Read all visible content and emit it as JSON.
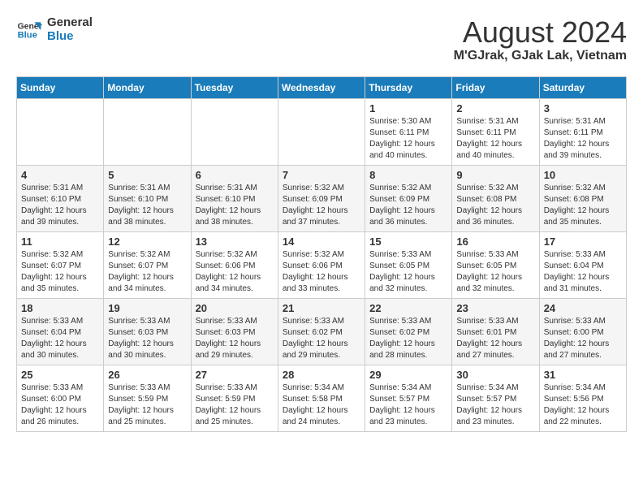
{
  "header": {
    "logo_line1": "General",
    "logo_line2": "Blue",
    "title": "August 2024",
    "subtitle": "M'GJrak, GJak Lak, Vietnam"
  },
  "weekdays": [
    "Sunday",
    "Monday",
    "Tuesday",
    "Wednesday",
    "Thursday",
    "Friday",
    "Saturday"
  ],
  "weeks": [
    [
      {
        "num": "",
        "info": ""
      },
      {
        "num": "",
        "info": ""
      },
      {
        "num": "",
        "info": ""
      },
      {
        "num": "",
        "info": ""
      },
      {
        "num": "1",
        "info": "Sunrise: 5:30 AM\nSunset: 6:11 PM\nDaylight: 12 hours\nand 40 minutes."
      },
      {
        "num": "2",
        "info": "Sunrise: 5:31 AM\nSunset: 6:11 PM\nDaylight: 12 hours\nand 40 minutes."
      },
      {
        "num": "3",
        "info": "Sunrise: 5:31 AM\nSunset: 6:11 PM\nDaylight: 12 hours\nand 39 minutes."
      }
    ],
    [
      {
        "num": "4",
        "info": "Sunrise: 5:31 AM\nSunset: 6:10 PM\nDaylight: 12 hours\nand 39 minutes."
      },
      {
        "num": "5",
        "info": "Sunrise: 5:31 AM\nSunset: 6:10 PM\nDaylight: 12 hours\nand 38 minutes."
      },
      {
        "num": "6",
        "info": "Sunrise: 5:31 AM\nSunset: 6:10 PM\nDaylight: 12 hours\nand 38 minutes."
      },
      {
        "num": "7",
        "info": "Sunrise: 5:32 AM\nSunset: 6:09 PM\nDaylight: 12 hours\nand 37 minutes."
      },
      {
        "num": "8",
        "info": "Sunrise: 5:32 AM\nSunset: 6:09 PM\nDaylight: 12 hours\nand 36 minutes."
      },
      {
        "num": "9",
        "info": "Sunrise: 5:32 AM\nSunset: 6:08 PM\nDaylight: 12 hours\nand 36 minutes."
      },
      {
        "num": "10",
        "info": "Sunrise: 5:32 AM\nSunset: 6:08 PM\nDaylight: 12 hours\nand 35 minutes."
      }
    ],
    [
      {
        "num": "11",
        "info": "Sunrise: 5:32 AM\nSunset: 6:07 PM\nDaylight: 12 hours\nand 35 minutes."
      },
      {
        "num": "12",
        "info": "Sunrise: 5:32 AM\nSunset: 6:07 PM\nDaylight: 12 hours\nand 34 minutes."
      },
      {
        "num": "13",
        "info": "Sunrise: 5:32 AM\nSunset: 6:06 PM\nDaylight: 12 hours\nand 34 minutes."
      },
      {
        "num": "14",
        "info": "Sunrise: 5:32 AM\nSunset: 6:06 PM\nDaylight: 12 hours\nand 33 minutes."
      },
      {
        "num": "15",
        "info": "Sunrise: 5:33 AM\nSunset: 6:05 PM\nDaylight: 12 hours\nand 32 minutes."
      },
      {
        "num": "16",
        "info": "Sunrise: 5:33 AM\nSunset: 6:05 PM\nDaylight: 12 hours\nand 32 minutes."
      },
      {
        "num": "17",
        "info": "Sunrise: 5:33 AM\nSunset: 6:04 PM\nDaylight: 12 hours\nand 31 minutes."
      }
    ],
    [
      {
        "num": "18",
        "info": "Sunrise: 5:33 AM\nSunset: 6:04 PM\nDaylight: 12 hours\nand 30 minutes."
      },
      {
        "num": "19",
        "info": "Sunrise: 5:33 AM\nSunset: 6:03 PM\nDaylight: 12 hours\nand 30 minutes."
      },
      {
        "num": "20",
        "info": "Sunrise: 5:33 AM\nSunset: 6:03 PM\nDaylight: 12 hours\nand 29 minutes."
      },
      {
        "num": "21",
        "info": "Sunrise: 5:33 AM\nSunset: 6:02 PM\nDaylight: 12 hours\nand 29 minutes."
      },
      {
        "num": "22",
        "info": "Sunrise: 5:33 AM\nSunset: 6:02 PM\nDaylight: 12 hours\nand 28 minutes."
      },
      {
        "num": "23",
        "info": "Sunrise: 5:33 AM\nSunset: 6:01 PM\nDaylight: 12 hours\nand 27 minutes."
      },
      {
        "num": "24",
        "info": "Sunrise: 5:33 AM\nSunset: 6:00 PM\nDaylight: 12 hours\nand 27 minutes."
      }
    ],
    [
      {
        "num": "25",
        "info": "Sunrise: 5:33 AM\nSunset: 6:00 PM\nDaylight: 12 hours\nand 26 minutes."
      },
      {
        "num": "26",
        "info": "Sunrise: 5:33 AM\nSunset: 5:59 PM\nDaylight: 12 hours\nand 25 minutes."
      },
      {
        "num": "27",
        "info": "Sunrise: 5:33 AM\nSunset: 5:59 PM\nDaylight: 12 hours\nand 25 minutes."
      },
      {
        "num": "28",
        "info": "Sunrise: 5:34 AM\nSunset: 5:58 PM\nDaylight: 12 hours\nand 24 minutes."
      },
      {
        "num": "29",
        "info": "Sunrise: 5:34 AM\nSunset: 5:57 PM\nDaylight: 12 hours\nand 23 minutes."
      },
      {
        "num": "30",
        "info": "Sunrise: 5:34 AM\nSunset: 5:57 PM\nDaylight: 12 hours\nand 23 minutes."
      },
      {
        "num": "31",
        "info": "Sunrise: 5:34 AM\nSunset: 5:56 PM\nDaylight: 12 hours\nand 22 minutes."
      }
    ]
  ]
}
